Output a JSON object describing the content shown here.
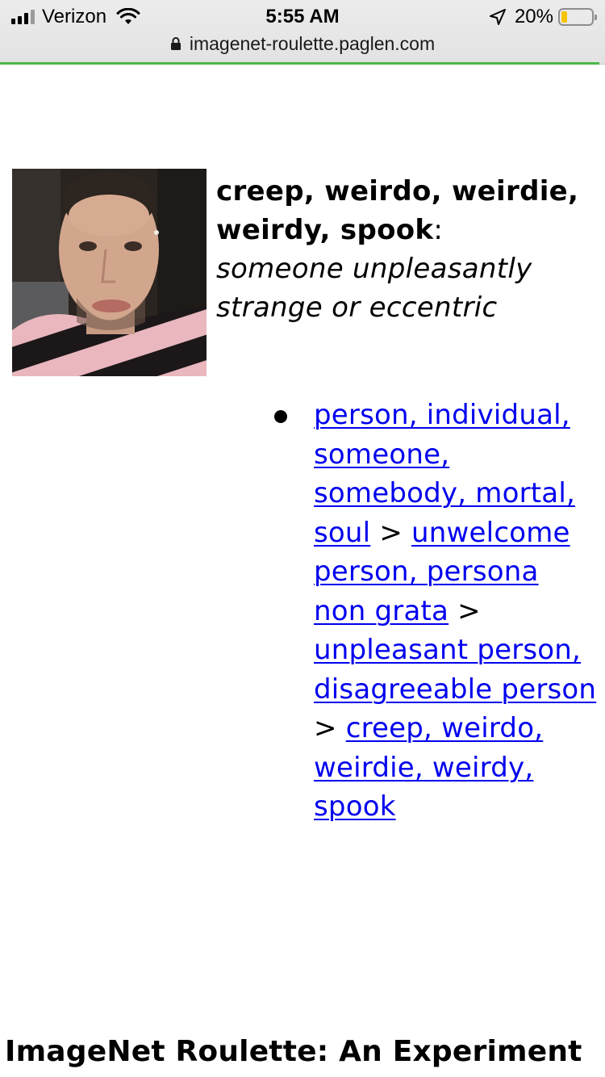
{
  "status_bar": {
    "carrier": "Verizon",
    "time": "5:55 AM",
    "battery_percent": "20%",
    "battery_level": 0.2,
    "signal_bars": 3,
    "icons": [
      "signal-icon",
      "wifi-icon",
      "location-arrow-icon",
      "battery-icon"
    ]
  },
  "browser": {
    "url": "imagenet-roulette.paglen.com",
    "lock_icon": "lock-icon",
    "load_progress": 0.99
  },
  "result": {
    "label": "creep, weirdo, weirdie, weirdy, spook",
    "separator": ":",
    "definition": "someone unpleasantly strange or eccentric",
    "photo_icon": "selfie-photo"
  },
  "hierarchy": {
    "links": [
      "person, individual, someone, somebody, mortal, soul",
      "unwelcome person, persona non grata",
      "unpleasant person, disagreeable person",
      "creep, weirdo, weirdie, weirdy, spook"
    ],
    "separator": ">"
  },
  "footer": {
    "title": "ImageNet Roulette: An Experiment"
  },
  "colors": {
    "link": "#0000ee",
    "progress": "#4cb849",
    "battery_low": "#f5c400"
  }
}
